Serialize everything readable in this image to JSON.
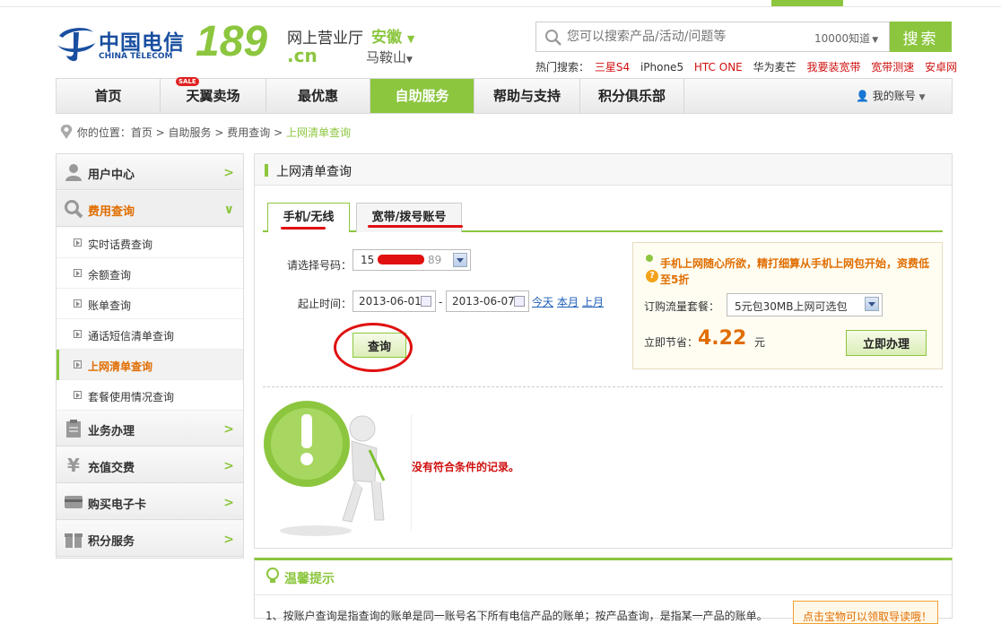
{
  "header": {
    "logo_cn": "中国电信",
    "logo_en": "CHINA TELECOM",
    "brand_number": "189",
    "brand_domain": ".cn",
    "hall_title": "网上营业厅",
    "province": "安徽",
    "city": "马鞍山",
    "search_placeholder": "您可以搜索产品/活动/问题等",
    "search_scope": "10000知道",
    "search_button": "搜索",
    "hot_label": "热门搜索：",
    "hot_items": [
      "三星S4",
      "iPhone5",
      "HTC ONE",
      "华为麦芒",
      "我要装宽带",
      "宽带测速",
      "安卓网"
    ]
  },
  "nav": {
    "items": [
      "首页",
      "天翼卖场",
      "最优惠",
      "自助服务",
      "帮助与支持",
      "积分俱乐部"
    ],
    "active": "自助服务",
    "sale_badge": "SALE",
    "account": "我的账号"
  },
  "breadcrumb": {
    "prefix": "你的位置：",
    "items": [
      "首页",
      "自助服务",
      "费用查询"
    ],
    "current": "上网清单查询"
  },
  "sidebar": {
    "user_center": "用户中心",
    "fee_query": "费用查询",
    "sub_items": [
      "实时话费查询",
      "余额查询",
      "账单查询",
      "通话短信清单查询",
      "上网清单查询",
      "套餐使用情况查询"
    ],
    "active_sub": "上网清单查询",
    "business": "业务办理",
    "recharge": "充值交费",
    "buy_card": "购买电子卡",
    "points": "积分服务"
  },
  "main": {
    "title": "上网清单查询",
    "tab_mobile": "手机/无线",
    "tab_broadband": "宽带/拨号账号",
    "number_label": "请选择号码：",
    "number_value": "15",
    "number_tail": "89",
    "date_label": "起止时间：",
    "date_start": "2013-06-01",
    "date_end": "2013-06-07",
    "date_sep": "-",
    "link_today": "今天",
    "link_month": "本月",
    "link_last_month": "上月",
    "query_button": "查询",
    "no_record": "没有符合条件的记录。"
  },
  "promo": {
    "headline": "手机上网随心所欲，精打细算从手机上网包开始，资费低至5折",
    "package_label": "订购流量套餐：",
    "package_value": "5元包30MB上网可选包",
    "save_label": "立即节省：",
    "save_amount": "4.22",
    "save_unit": "元",
    "apply_button": "立即办理"
  },
  "tips": {
    "title": "温馨提示",
    "text": "1、按账户查询是指查询的账单是同一账号名下所有电信产品的账单；按产品查询，是指某一产品的账单。",
    "side_button": "点击宝物可以领取导读哦！"
  },
  "colors": {
    "brand_green": "#8cc63f",
    "telecom_blue": "#1a4fa0",
    "orange": "#e06d00",
    "annotation_red": "#e01010"
  }
}
